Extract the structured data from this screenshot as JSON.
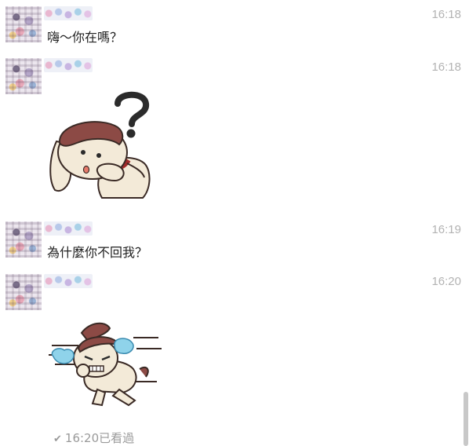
{
  "messages": [
    {
      "type": "text",
      "time": "16:18",
      "text": "嗨～你在嗎？"
    },
    {
      "type": "sticker",
      "time": "16:18",
      "sticker": "confused-dog-question-mark-icon"
    },
    {
      "type": "text",
      "time": "16:19",
      "text": "為什麼你不回我？"
    },
    {
      "type": "sticker",
      "time": "16:20",
      "sticker": "crying-running-dog-icon"
    }
  ],
  "read_receipt": {
    "icon": "checkmark-icon",
    "text": "16:20已看過"
  }
}
